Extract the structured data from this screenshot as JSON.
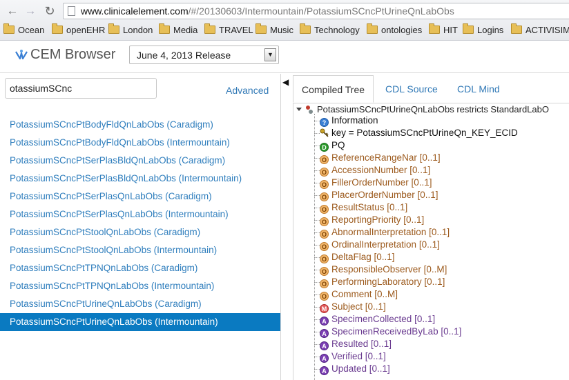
{
  "browser": {
    "url_domain": "www.clinicalelement.com",
    "url_path": "/#/20130603/Intermountain/PotassiumSCncPtUrineQnLabObs",
    "bookmarks": [
      "Ocean",
      "openEHR",
      "London",
      "Media",
      "TRAVEL",
      "Music",
      "Technology",
      "ontologies",
      "HIT",
      "Logins",
      "ACTIVISIM"
    ]
  },
  "app": {
    "title": "CEM Browser",
    "release_selected": "June 4, 2013 Release"
  },
  "search": {
    "value": "otassiumSCnc",
    "advanced_label": "Advanced"
  },
  "results": [
    "PotassiumSCncPtBodyFldQnLabObs (Caradigm)",
    "PotassiumSCncPtBodyFldQnLabObs (Intermountain)",
    "PotassiumSCncPtSerPlasBldQnLabObs (Caradigm)",
    "PotassiumSCncPtSerPlasBldQnLabObs (Intermountain)",
    "PotassiumSCncPtSerPlasQnLabObs (Caradigm)",
    "PotassiumSCncPtSerPlasQnLabObs (Intermountain)",
    "PotassiumSCncPtStoolQnLabObs (Caradigm)",
    "PotassiumSCncPtStoolQnLabObs (Intermountain)",
    "PotassiumSCncPtTPNQnLabObs (Caradigm)",
    "PotassiumSCncPtTPNQnLabObs (Intermountain)",
    "PotassiumSCncPtUrineQnLabObs (Caradigm)",
    "PotassiumSCncPtUrineQnLabObs (Intermountain)"
  ],
  "selected_result": "PotassiumSCncPtUrineQnLabObs (Intermountain)",
  "tabs": {
    "compiled": "Compiled Tree",
    "cdl_source": "CDL Source",
    "cdl_mind": "CDL Mind"
  },
  "tree": {
    "root": "PotassiumSCncPtUrineQnLabObs restricts StandardLabO",
    "nodes": [
      {
        "icon": "info",
        "label": "Information"
      },
      {
        "icon": "key",
        "label": "key = PotassiumSCncPtUrineQn_KEY_ECID"
      },
      {
        "icon": "D",
        "label": "PQ"
      },
      {
        "icon": "O",
        "label": "ReferenceRangeNar [0..1]"
      },
      {
        "icon": "O",
        "label": "AccessionNumber [0..1]"
      },
      {
        "icon": "O",
        "label": "FillerOrderNumber [0..1]"
      },
      {
        "icon": "O",
        "label": "PlacerOrderNumber [0..1]"
      },
      {
        "icon": "O",
        "label": "ResultStatus [0..1]"
      },
      {
        "icon": "O",
        "label": "ReportingPriority [0..1]"
      },
      {
        "icon": "O",
        "label": "AbnormalInterpretation [0..1]"
      },
      {
        "icon": "O",
        "label": "OrdinalInterpretation [0..1]"
      },
      {
        "icon": "O",
        "label": "DeltaFlag [0..1]"
      },
      {
        "icon": "O",
        "label": "ResponsibleObserver [0..M]"
      },
      {
        "icon": "O",
        "label": "PerformingLaboratory [0..1]"
      },
      {
        "icon": "O",
        "label": "Comment [0..M]"
      },
      {
        "icon": "M",
        "label": "Subject [0..1]"
      },
      {
        "icon": "A",
        "label": "SpecimenCollected [0..1]"
      },
      {
        "icon": "A",
        "label": "SpecimenReceivedByLab [0..1]"
      },
      {
        "icon": "A",
        "label": "Resulted [0..1]"
      },
      {
        "icon": "A",
        "label": "Verified [0..1]"
      },
      {
        "icon": "A",
        "label": "Updated [0..1]"
      }
    ]
  },
  "colors": {
    "link": "#2f7ebd",
    "selected_bg": "#0a7ac1",
    "attr_brown": "#9c5a1d",
    "attr_purple": "#6a3b90"
  }
}
